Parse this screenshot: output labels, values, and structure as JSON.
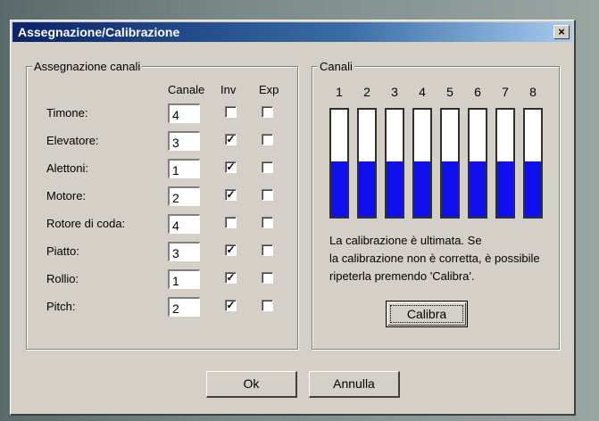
{
  "window": {
    "title": "Assegnazione/Calibrazione"
  },
  "assignment": {
    "group_label": "Assegnazione canali",
    "col_channel": "Canale",
    "col_inv": "Inv",
    "col_exp": "Exp",
    "rows": [
      {
        "label": "Timone:",
        "channel": "4",
        "inv": "",
        "exp": ""
      },
      {
        "label": "Elevatore:",
        "channel": "3",
        "inv": "✓",
        "exp": ""
      },
      {
        "label": "Alettoni:",
        "channel": "1",
        "inv": "✓",
        "exp": ""
      },
      {
        "label": "Motore:",
        "channel": "2",
        "inv": "✓",
        "exp": ""
      },
      {
        "label": "Rotore di coda:",
        "channel": "4",
        "inv": "",
        "exp": ""
      },
      {
        "label": "Piatto:",
        "channel": "3",
        "inv": "✓",
        "exp": ""
      },
      {
        "label": "Rollio:",
        "channel": "1",
        "inv": "✓",
        "exp": ""
      },
      {
        "label": "Pitch:",
        "channel": "2",
        "inv": "✓",
        "exp": ""
      }
    ]
  },
  "channels": {
    "group_label": "Canali",
    "numbers": [
      "1",
      "2",
      "3",
      "4",
      "5",
      "6",
      "7",
      "8"
    ],
    "levels": [
      0.52,
      0.52,
      0.52,
      0.52,
      0.52,
      0.52,
      0.52,
      0.52
    ],
    "fill_color": "#1010ee",
    "status_line1": "La calibrazione è ultimata. Se",
    "status_line2": "la calibrazione non è corretta, è possibile",
    "status_line3": "ripeterla premendo 'Calibra'.",
    "calibrate_label": "Calibra"
  },
  "buttons": {
    "ok": "Ok",
    "cancel": "Annulla"
  },
  "icons": {
    "close": "close-icon"
  }
}
